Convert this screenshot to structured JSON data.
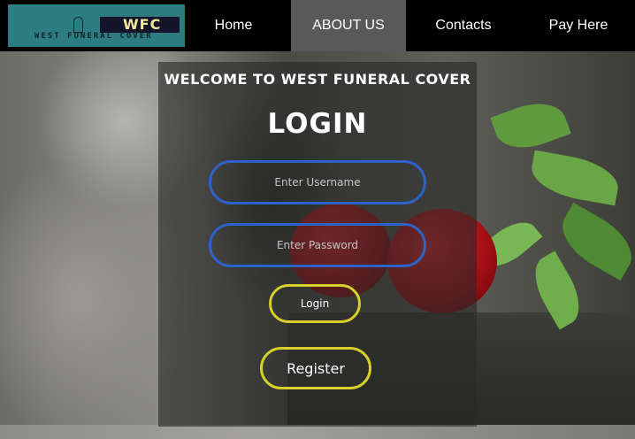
{
  "brand": {
    "abbr": "WFC",
    "name": "WEST FUNERAL COVER"
  },
  "nav": {
    "items": [
      {
        "label": "Home",
        "active": false
      },
      {
        "label": "ABOUT US",
        "active": true
      },
      {
        "label": "Contacts",
        "active": false
      },
      {
        "label": "Pay Here",
        "active": false
      }
    ]
  },
  "login": {
    "welcome": "WELCOME TO WEST FUNERAL COVER",
    "title": "LOGIN",
    "username_placeholder": "Enter Username",
    "password_placeholder": "Enter Password",
    "login_label": "Login",
    "register_label": "Register"
  },
  "colors": {
    "nav_bg": "#000000",
    "nav_active_bg": "#595959",
    "field_border": "#2d63c8",
    "button_border": "#d8d02a",
    "logo_bg": "#2d7d80"
  }
}
